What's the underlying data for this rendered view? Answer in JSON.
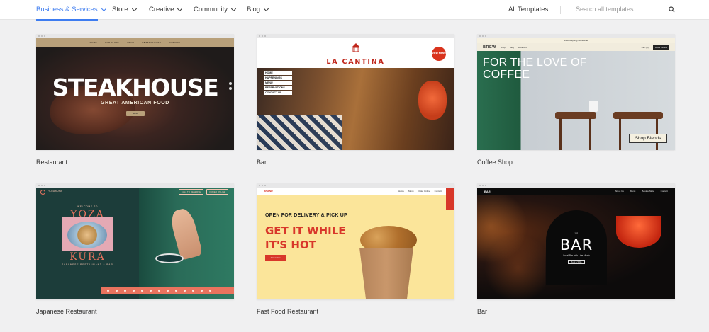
{
  "nav": {
    "items": [
      {
        "label": "Business & Services",
        "active": true
      },
      {
        "label": "Store"
      },
      {
        "label": "Creative"
      },
      {
        "label": "Community"
      },
      {
        "label": "Blog"
      }
    ],
    "all_templates": "All Templates",
    "search_placeholder": "Search all templates...",
    "accent_color": "#3d7cf0"
  },
  "templates": [
    {
      "category": "Restaurant",
      "preview": {
        "menu": [
          "HOME",
          "OUR STORY",
          "MENU",
          "RESERVATIONS",
          "CONTACT"
        ],
        "title": "STEAKHOUSE",
        "subtitle": "GREAT AMERICAN FOOD",
        "button": "MENU"
      }
    },
    {
      "category": "Bar",
      "preview": {
        "title": "LA CANTINA",
        "badge": "VIEW MENU",
        "menu": [
          "HOME",
          "HAPPENINGS",
          "MENU",
          "RESERVATIONS",
          "CONTACT US"
        ]
      }
    },
    {
      "category": "Coffee Shop",
      "preview": {
        "banner": "Free Shipping Worldwide",
        "brand": "BREW",
        "menu": [
          "Shop",
          "Blog",
          "Locations"
        ],
        "cart": "Cart (0)",
        "order_button": "Order Online",
        "headline": "FOR THE LOVE OF COFFEE",
        "button": "Shop Blends"
      }
    },
    {
      "category": "Japanese Restaurant",
      "preview": {
        "brand": "YOZA KURA",
        "nav_buttons": [
          "CALL TO RESERVE",
          "ORDER ONLINE"
        ],
        "welcome": "WELCOME TO",
        "title_top": "YOZA",
        "title_bottom": "KURA",
        "subtitle": "JAPANESE RESTAURANT & BAR"
      }
    },
    {
      "category": "Fast Food Restaurant",
      "preview": {
        "brand": "BRAND",
        "menu": [
          "Home",
          "Menu",
          "Order Online",
          "Contact"
        ],
        "pre_title": "OPEN FOR DELIVERY & PICK UP",
        "headline": "GET IT WHILE IT'S HOT",
        "button": "Order Now"
      }
    },
    {
      "category": "Bar",
      "preview": {
        "brand": "BAR",
        "menu": [
          "About Us",
          "Menu",
          "Book a Table",
          "Contact"
        ],
        "number": "101",
        "title": "BAR",
        "subtitle": "Local Bar with Live Music",
        "button": "Book a Table"
      }
    }
  ]
}
